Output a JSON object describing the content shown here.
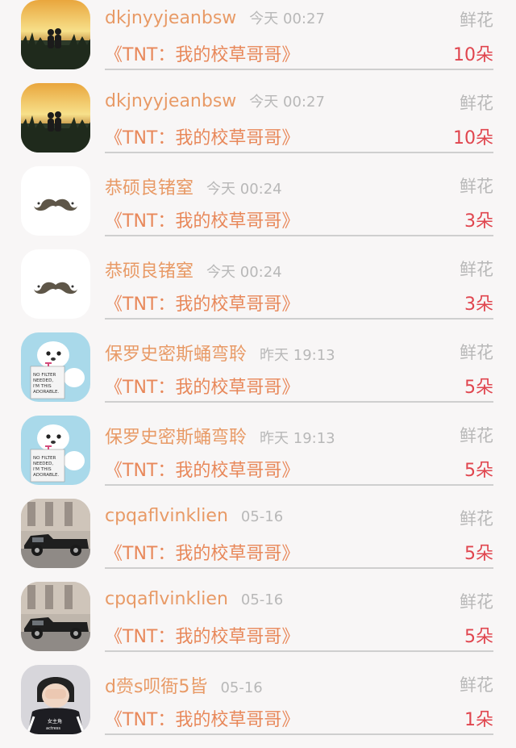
{
  "gift_rows": [
    {
      "user": "dkjnyyjeanbsw",
      "time": "今天 00:27",
      "gift": "鲜花",
      "work": "《TNT：我的校草哥哥》",
      "count": "10朵",
      "avatar": "sunset-couple-avatar"
    },
    {
      "user": "dkjnyyjeanbsw",
      "time": "今天 00:27",
      "gift": "鲜花",
      "work": "《TNT：我的校草哥哥》",
      "count": "10朵",
      "avatar": "sunset-couple-avatar"
    },
    {
      "user": "恭硕良锗窒",
      "time": "今天 00:24",
      "gift": "鲜花",
      "work": "《TNT：我的校草哥哥》",
      "count": "3朵",
      "avatar": "mustache-avatar"
    },
    {
      "user": "恭硕良锗窒",
      "time": "今天 00:24",
      "gift": "鲜花",
      "work": "《TNT：我的校草哥哥》",
      "count": "3朵",
      "avatar": "mustache-avatar"
    },
    {
      "user": "保罗史密斯蛹弯聆",
      "time": "昨天 19:13",
      "gift": "鲜花",
      "work": "《TNT：我的校草哥哥》",
      "count": "5朵",
      "avatar": "dog-sign-avatar"
    },
    {
      "user": "保罗史密斯蛹弯聆",
      "time": "昨天 19:13",
      "gift": "鲜花",
      "work": "《TNT：我的校草哥哥》",
      "count": "5朵",
      "avatar": "dog-sign-avatar"
    },
    {
      "user": "cpqaflvinklien",
      "time": "05-16",
      "gift": "鲜花",
      "work": "《TNT：我的校草哥哥》",
      "count": "5朵",
      "avatar": "vintage-car-avatar"
    },
    {
      "user": "cpqaflvinklien",
      "time": "05-16",
      "gift": "鲜花",
      "work": "《TNT：我的校草哥哥》",
      "count": "5朵",
      "avatar": "vintage-car-avatar"
    },
    {
      "user": "d赍s呗衙5皆",
      "time": "05-16",
      "gift": "鲜花",
      "work": "《TNT：我的校草哥哥》",
      "count": "1朵",
      "avatar": "person-covering-face-avatar"
    }
  ],
  "dog_sign_text": "NO FILTER NEEDED, I'M THIS ADORABLE.",
  "shirt_text": "女主角 actress",
  "colors": {
    "background": "#f8f6f6",
    "name": "#e89a66",
    "work": "#e8885a",
    "count": "#e0454e",
    "muted": "#b8b8b8",
    "divider": "#cfcfcf"
  }
}
